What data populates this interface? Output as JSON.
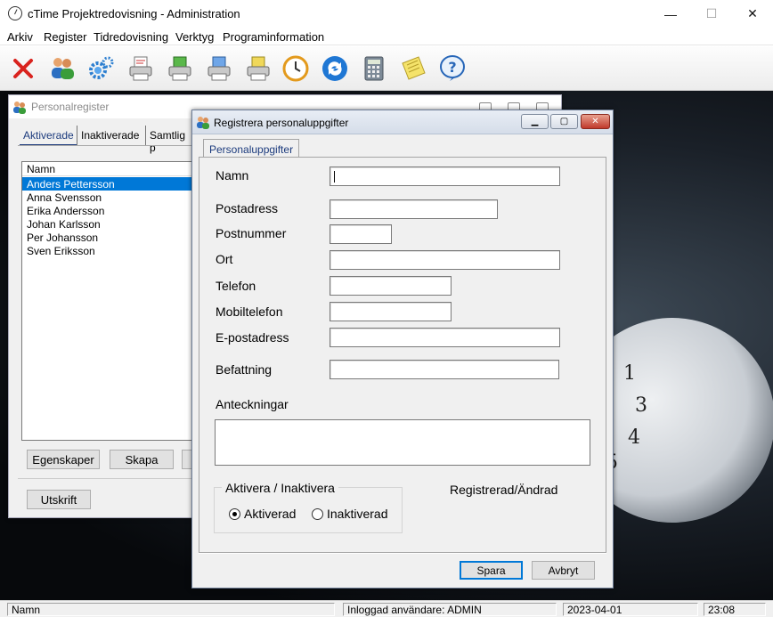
{
  "app": {
    "title": "cTime Projektredovisning - Administration"
  },
  "window_controls": {
    "minimize": "—",
    "maximize": "☐",
    "close": "✕"
  },
  "menu": [
    "Arkiv",
    "Register",
    "Tidredovisning",
    "Verktyg",
    "Programinformation"
  ],
  "toolbar": [
    {
      "icon": "close-icon"
    },
    {
      "icon": "users-icon"
    },
    {
      "icon": "gears-icon"
    },
    {
      "icon": "printer-report-icon"
    },
    {
      "icon": "printer-green-icon"
    },
    {
      "icon": "printer-blue-icon"
    },
    {
      "icon": "printer-yellow-icon"
    },
    {
      "icon": "clock-icon"
    },
    {
      "icon": "sync-icon"
    },
    {
      "icon": "calculator-icon"
    },
    {
      "icon": "notepad-icon"
    },
    {
      "icon": "help-icon"
    }
  ],
  "personalregister": {
    "title": "Personalregister",
    "tabs": [
      "Aktiverade",
      "Inaktiverade",
      "Samtlig p"
    ],
    "list_header": "Namn",
    "rows": [
      "Anders Pettersson",
      "Anna Svensson",
      "Erika Andersson",
      "Johan Karlsson",
      "Per Johansson",
      "Sven Eriksson"
    ],
    "selected_row": 0,
    "buttons": {
      "properties": "Egenskaper",
      "create": "Skapa",
      "print": "Utskrift"
    }
  },
  "dialog": {
    "title": "Registrera personaluppgifter",
    "tab": "Personaluppgifter",
    "fields": {
      "name": "Namn",
      "postal_address": "Postadress",
      "postal_code": "Postnummer",
      "city": "Ort",
      "phone": "Telefon",
      "mobile": "Mobiltelefon",
      "email": "E-postadress",
      "position": "Befattning",
      "notes": "Anteckningar"
    },
    "activation": {
      "legend": "Aktivera / Inaktivera",
      "activated": "Aktiverad",
      "deactivated": "Inaktiverad",
      "selected": "Aktiverad"
    },
    "registered_label": "Registrerad/Ändrad",
    "save": "Spara",
    "cancel": "Avbryt"
  },
  "statusbar": {
    "field": "Namn",
    "user": "Inloggad användare: ADMIN",
    "date": "2023-04-01",
    "time": "23:08"
  },
  "colors": {
    "selection": "#0078d7",
    "accent": "#1c3b7d",
    "close_red": "#c42b1c"
  }
}
